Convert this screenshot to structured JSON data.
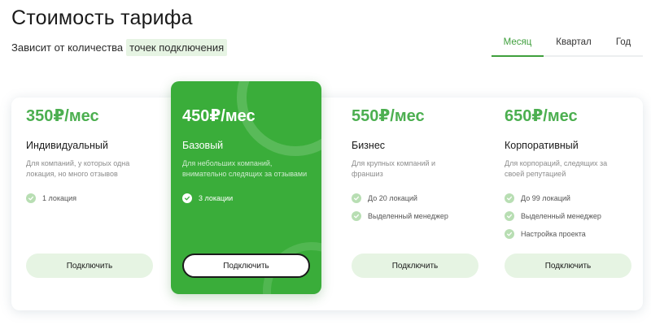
{
  "header": {
    "title": "Стоимость тарифа",
    "subtitle_prefix": "Зависит от количества",
    "subtitle_highlight": "точек подключения"
  },
  "period_tabs": [
    {
      "label": "Месяц",
      "active": true
    },
    {
      "label": "Квартал",
      "active": false
    },
    {
      "label": "Год",
      "active": false
    }
  ],
  "colors": {
    "accent": "#3aad3a",
    "price_green": "#4caf50",
    "button_bg": "#e6f4e3",
    "check_bg": "#b8deb3"
  },
  "plans": [
    {
      "price": "350₽/мес",
      "name": "Индивидуальный",
      "description": "Для компаний, у которых одна локация, но много отзывов",
      "features": [
        "1 локация"
      ],
      "button": "Подключить",
      "featured": false
    },
    {
      "price": "450₽/мес",
      "name": "Базовый",
      "description": "Для небольших компаний, внимательно следящих за отзывами",
      "features": [
        "3 локации"
      ],
      "button": "Подключить",
      "featured": true
    },
    {
      "price": "550₽/мес",
      "name": "Бизнес",
      "description": "Для крупных компаний и франшиз",
      "features": [
        "До 20 локаций",
        "Выделенный менеджер"
      ],
      "button": "Подключить",
      "featured": false
    },
    {
      "price": "650₽/мес",
      "name": "Корпоративный",
      "description": "Для корпораций, следящих за своей репутацией",
      "features": [
        "До 99 локаций",
        "Выделенный менеджер",
        "Настройка проекта"
      ],
      "button": "Подключить",
      "featured": false
    }
  ]
}
